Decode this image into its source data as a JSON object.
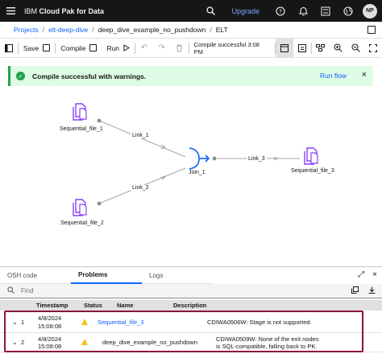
{
  "header": {
    "brand_prefix": "IBM ",
    "brand_name": "Cloud Pak for Data",
    "upgrade_label": "Upgrade",
    "avatar_initials": "NP",
    "icons": [
      "search-icon",
      "help-icon",
      "notification-icon",
      "switcher-icon",
      "global-icon"
    ]
  },
  "breadcrumb": {
    "items": [
      "Projects",
      "elt-deep-dive",
      "deep_dive_example_no_pushdown",
      "ELT"
    ]
  },
  "toolbar": {
    "save_label": "Save",
    "compile_label": "Compile",
    "run_label": "Run",
    "status_text": "Compile successful 3:08 PM"
  },
  "notification": {
    "message": "Compile successful with warnings.",
    "action_label": "Run flow"
  },
  "canvas": {
    "nodes": [
      {
        "label": "Sequential_file_1",
        "type": "file"
      },
      {
        "label": "Sequential_file_2",
        "type": "file"
      },
      {
        "label": "Join_1",
        "type": "join"
      },
      {
        "label": "Sequential_file_3",
        "type": "file"
      }
    ],
    "links": [
      "Link_1",
      "Link_2",
      "Link_3"
    ],
    "colors": {
      "file_icon": "#8a3ffc",
      "join_icon": "#0f62fe",
      "link": "#8d8d8d"
    }
  },
  "panel": {
    "tabs": [
      "OSH code",
      "Problems",
      "Logs"
    ],
    "active_tab": "Problems",
    "find_placeholder": "Find",
    "columns": [
      "Timestamp",
      "Status",
      "Name",
      "Description"
    ],
    "rows": [
      {
        "index": "1",
        "date": "4/8/2024",
        "time": "15:08:08",
        "status": "warning",
        "name": "Sequential_file_3",
        "description": [
          "CDIWA0506W: Stage is not supported."
        ]
      },
      {
        "index": "2",
        "date": "4/8/2024",
        "time": "15:08:08",
        "status": "warning",
        "name": "deep_dive_example_no_pushdown",
        "description": [
          "CDIWA0509W: None of the exit nodes",
          "is SQL-compatible, falling back to PK."
        ]
      }
    ]
  }
}
